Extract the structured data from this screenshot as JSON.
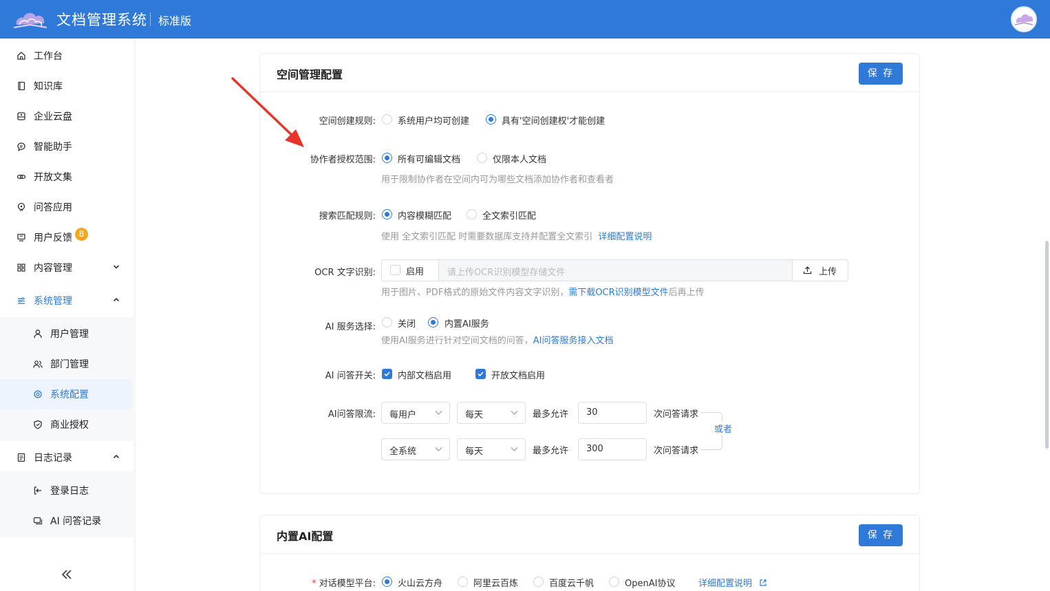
{
  "header": {
    "app_title": "文档管理系统",
    "edition": "标准版",
    "brand_color": "#2f7ad9"
  },
  "sidebar": {
    "items": [
      {
        "label": "工作台",
        "icon": "home-icon"
      },
      {
        "label": "知识库",
        "icon": "book-icon"
      },
      {
        "label": "企业云盘",
        "icon": "cloud-drive-icon"
      },
      {
        "label": "智能助手",
        "icon": "chat-icon"
      },
      {
        "label": "开放文集",
        "icon": "link-icon"
      },
      {
        "label": "问答应用",
        "icon": "qa-app-icon"
      },
      {
        "label": "用户反馈",
        "icon": "feedback-icon",
        "badge": "8"
      },
      {
        "label": "内容管理",
        "icon": "grid-icon"
      },
      {
        "label": "系统管理",
        "icon": "sliders-icon"
      },
      {
        "label": "日志记录",
        "icon": "log-icon"
      }
    ],
    "system_sub": [
      {
        "label": "用户管理",
        "icon": "user-icon"
      },
      {
        "label": "部门管理",
        "icon": "users-icon"
      },
      {
        "label": "系统配置",
        "icon": "gear-icon"
      },
      {
        "label": "商业授权",
        "icon": "shield-icon"
      }
    ],
    "log_sub": [
      {
        "label": "登录日志",
        "icon": "login-icon"
      },
      {
        "label": "AI 问答记录",
        "icon": "qa-record-icon"
      }
    ]
  },
  "space_config": {
    "title": "空间管理配置",
    "save_label": "保 存",
    "create_rule": {
      "label": "空间创建规则:",
      "options": [
        "系统用户均可创建",
        "具有'空间创建权'才能创建"
      ],
      "selected": 1
    },
    "collab_scope": {
      "label": "协作者授权范围:",
      "options": [
        "所有可编辑文档",
        "仅限本人文档"
      ],
      "selected": 0,
      "help": "用于限制协作者在空间内可为哪些文档添加协作者和查看者"
    },
    "search_rule": {
      "label": "搜索匹配规则:",
      "options": [
        "内容模糊匹配",
        "全文索引匹配"
      ],
      "selected": 0,
      "help": "使用 全文索引匹配 时需要数据库支持并配置全文索引",
      "help_link": "详细配置说明"
    },
    "ocr": {
      "label": "OCR 文字识别:",
      "enable_label": "启用",
      "placeholder": "请上传OCR识别模型存储文件",
      "upload_label": "上传",
      "help_prefix": "用于图片、PDF格式的原始文件内容文字识别，",
      "help_link": "需下载OCR识别模型文件",
      "help_suffix": "后再上传"
    },
    "ai_service": {
      "label": "AI 服务选择:",
      "options": [
        "关闭",
        "内置AI服务"
      ],
      "selected": 1,
      "help_prefix": "使用AI服务进行针对空间文档的问答，",
      "help_link": "AI问答服务接入文档"
    },
    "ai_switch": {
      "label": "AI 问答开关:",
      "options": [
        "内部文档启用",
        "开放文档启用"
      ]
    },
    "ai_limit": {
      "label": "AI问答限流:",
      "rows": [
        {
          "scope": "每用户",
          "period": "每天",
          "max_label": "最多允许",
          "value": "30",
          "unit": "次问答请求"
        },
        {
          "scope": "全系统",
          "period": "每天",
          "max_label": "最多允许",
          "value": "300",
          "unit": "次问答请求"
        }
      ],
      "or_label": "或者"
    }
  },
  "ai_config": {
    "title": "内置AI配置",
    "save_label": "保 存",
    "platform": {
      "required_mark": "*",
      "label": "对话模型平台:",
      "options": [
        "火山云方舟",
        "阿里云百炼",
        "百度云千帆",
        "OpenAI协议"
      ],
      "selected": 0,
      "link": "详细配置说明"
    }
  }
}
